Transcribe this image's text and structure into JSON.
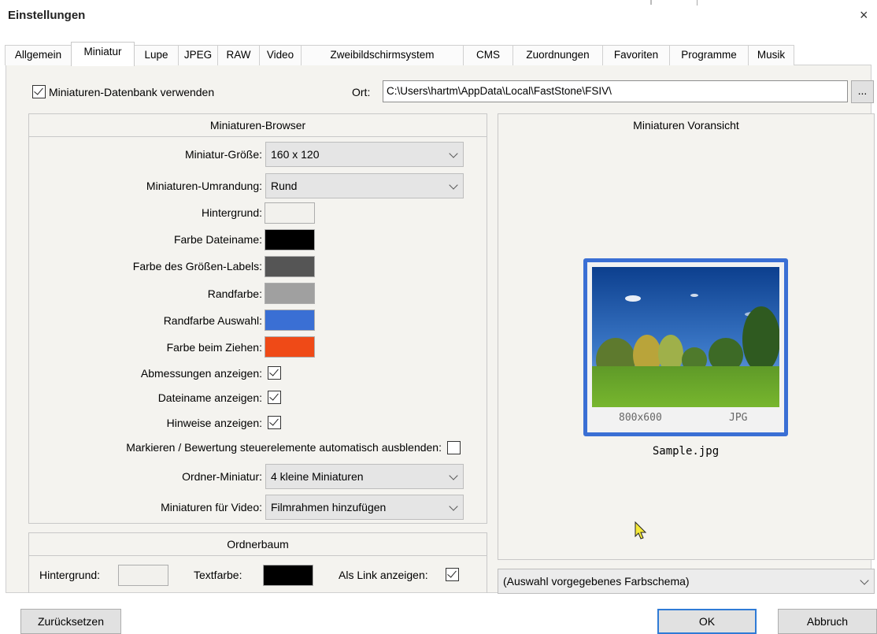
{
  "window": {
    "title": "Einstellungen",
    "close_glyph": "×"
  },
  "tabs": [
    {
      "label": "Allgemein"
    },
    {
      "label": "Miniatur"
    },
    {
      "label": "Lupe"
    },
    {
      "label": "JPEG"
    },
    {
      "label": "RAW"
    },
    {
      "label": "Video"
    },
    {
      "label": "Zweibildschirmsystem"
    },
    {
      "label": "CMS"
    },
    {
      "label": "Zuordnungen"
    },
    {
      "label": "Favoriten"
    },
    {
      "label": "Programme"
    },
    {
      "label": "Musik"
    }
  ],
  "active_tab": "Miniatur",
  "database": {
    "checkbox_label": "Miniaturen-Datenbank verwenden",
    "checked": true,
    "location_label": "Ort:",
    "location_value": "C:\\Users\\hartm\\AppData\\Local\\FastStone\\FSIV\\",
    "browse_label": "..."
  },
  "browser": {
    "header": "Miniaturen-Browser",
    "size_label": "Miniatur-Größe:",
    "size_value": "160 x 120",
    "border_label": "Miniaturen-Umrandung:",
    "border_value": "Rund",
    "background_label": "Hintergrund:",
    "filename_color_label": "Farbe Dateiname:",
    "size_label_color_label": "Farbe des Größen-Labels:",
    "border_color_label": "Randfarbe:",
    "selection_border_label": "Randfarbe Auswahl:",
    "drag_color_label": "Farbe beim Ziehen:",
    "show_dimensions_label": "Abmessungen anzeigen:",
    "show_filename_label": "Dateiname anzeigen:",
    "show_hints_label": "Hinweise anzeigen:",
    "autohide_label": "Markieren / Bewertung steuerelemente automatisch ausblenden:",
    "folder_thumb_label": "Ordner-Miniatur:",
    "folder_thumb_value": "4 kleine Miniaturen",
    "video_thumb_label": "Miniaturen für Video:",
    "video_thumb_value": "Filmrahmen hinzufügen",
    "colors": {
      "background": "#f2f1ed",
      "filename": "#000000",
      "size_label": "#555555",
      "border": "#a0a0a0",
      "selection_border": "#3a6fd4",
      "drag": "#ef4a17"
    }
  },
  "folder_tree": {
    "header": "Ordnerbaum",
    "background_label": "Hintergrund:",
    "text_color_label": "Textfarbe:",
    "show_as_link_label": "Als Link anzeigen:",
    "colors": {
      "background": "#f2f1ed",
      "text": "#000000"
    }
  },
  "preview": {
    "header": "Miniaturen Voransicht",
    "dimensions": "800x600",
    "format": "JPG",
    "filename": "Sample.jpg",
    "scheme_value": "(Auswahl vorgegebenes Farbschema)"
  },
  "buttons": {
    "reset": "Zurücksetzen",
    "ok": "OK",
    "cancel": "Abbruch"
  }
}
